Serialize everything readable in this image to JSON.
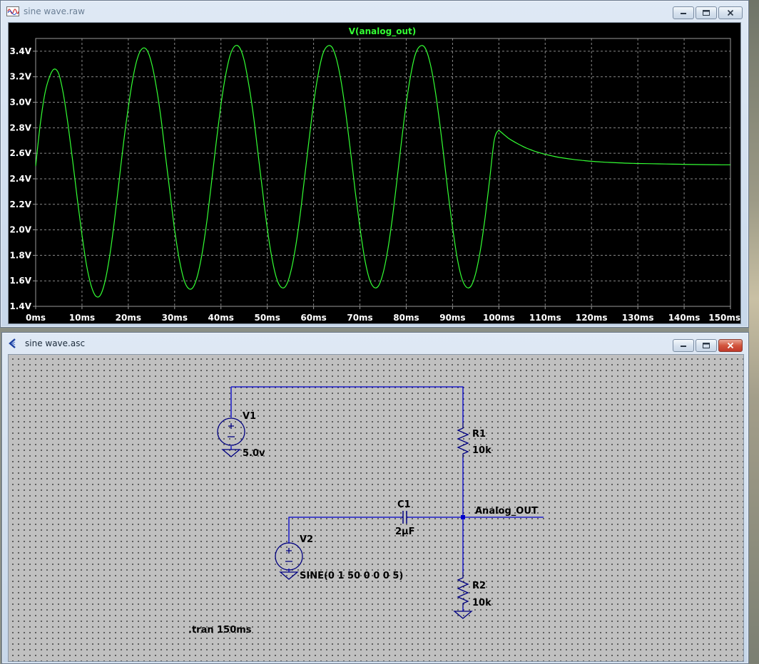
{
  "plot_window": {
    "title": "sine wave.raw",
    "icon": "waveform-icon"
  },
  "schematic_window": {
    "title": "sine wave.asc",
    "icon": "ltspice-schematic-icon"
  },
  "chart_data": {
    "type": "line",
    "title": "V(analog_out)",
    "xlabel": "",
    "ylabel": "",
    "xlim": [
      0,
      150
    ],
    "ylim": [
      1.4,
      3.5
    ],
    "x_ticks": [
      "0ms",
      "10ms",
      "20ms",
      "30ms",
      "40ms",
      "50ms",
      "60ms",
      "70ms",
      "80ms",
      "90ms",
      "100ms",
      "110ms",
      "120ms",
      "130ms",
      "140ms",
      "150ms"
    ],
    "y_ticks": [
      "1.4V",
      "1.6V",
      "1.8V",
      "2.0V",
      "2.2V",
      "2.4V",
      "2.6V",
      "2.8V",
      "3.0V",
      "3.2V",
      "3.4V"
    ],
    "y_tick_values": [
      1.4,
      1.6,
      1.8,
      2.0,
      2.2,
      2.4,
      2.6,
      2.8,
      3.0,
      3.2,
      3.4
    ],
    "grid": true,
    "series": [
      {
        "name": "V(analog_out)",
        "color": "#33ff33",
        "x": [
          0,
          1,
          2,
          3,
          4,
          5,
          6,
          7,
          8,
          9,
          10,
          11,
          12,
          13,
          14,
          15,
          16,
          17,
          18,
          19,
          20,
          21,
          22,
          23,
          24,
          25,
          26,
          27,
          28,
          29,
          30,
          31,
          32,
          33,
          34,
          35,
          36,
          37,
          38,
          39,
          40,
          41,
          42,
          43,
          44,
          45,
          46,
          47,
          48,
          49,
          50,
          51,
          52,
          53,
          54,
          55,
          56,
          57,
          58,
          59,
          60,
          61,
          62,
          63,
          64,
          65,
          66,
          67,
          68,
          69,
          70,
          71,
          72,
          73,
          74,
          75,
          76,
          77,
          78,
          79,
          80,
          81,
          82,
          83,
          84,
          85,
          86,
          87,
          88,
          89,
          90,
          91,
          92,
          93,
          94,
          95,
          96,
          97,
          98,
          99,
          100,
          101,
          102,
          103,
          104,
          105,
          106,
          107,
          108,
          109,
          110,
          112,
          114,
          116,
          118,
          120,
          122,
          124,
          126,
          128,
          130,
          133,
          136,
          139,
          142,
          145,
          148,
          150
        ],
        "y": [
          2.5,
          2.83,
          3.07,
          3.2,
          3.26,
          3.22,
          3.06,
          2.82,
          2.54,
          2.24,
          1.96,
          1.72,
          1.56,
          1.48,
          1.49,
          1.6,
          1.8,
          2.07,
          2.38,
          2.69,
          2.96,
          3.19,
          3.35,
          3.42,
          3.41,
          3.31,
          3.13,
          2.89,
          2.59,
          2.29,
          2.0,
          1.77,
          1.61,
          1.54,
          1.55,
          1.65,
          1.83,
          2.08,
          2.38,
          2.69,
          2.98,
          3.21,
          3.37,
          3.44,
          3.43,
          3.33,
          3.14,
          2.9,
          2.6,
          2.3,
          2.01,
          1.78,
          1.62,
          1.55,
          1.56,
          1.66,
          1.84,
          2.09,
          2.39,
          2.7,
          2.99,
          3.22,
          3.38,
          3.44,
          3.43,
          3.33,
          3.15,
          2.9,
          2.61,
          2.3,
          2.02,
          1.78,
          1.62,
          1.55,
          1.56,
          1.66,
          1.84,
          2.09,
          2.39,
          2.7,
          2.99,
          3.22,
          3.38,
          3.44,
          3.43,
          3.33,
          3.15,
          2.9,
          2.61,
          2.3,
          2.02,
          1.78,
          1.62,
          1.55,
          1.56,
          1.66,
          1.84,
          2.09,
          2.39,
          2.7,
          2.78,
          2.75,
          2.72,
          2.697,
          2.676,
          2.657,
          2.64,
          2.626,
          2.613,
          2.602,
          2.592,
          2.575,
          2.562,
          2.552,
          2.544,
          2.537,
          2.532,
          2.528,
          2.525,
          2.522,
          2.52,
          2.518,
          2.516,
          2.514,
          2.512,
          2.511,
          2.51,
          2.51
        ]
      }
    ]
  },
  "schematic": {
    "v1": {
      "name": "V1",
      "value": "5.0v"
    },
    "r1": {
      "name": "R1",
      "value": "10k"
    },
    "c1": {
      "name": "C1",
      "value": "2µF"
    },
    "v2": {
      "name": "V2",
      "value": "SINE(0 1 50 0 0 0 5)"
    },
    "r2": {
      "name": "R2",
      "value": "10k"
    },
    "net_label": "Analog_OUT",
    "directive": ".tran 150ms",
    "wire_color": "#0000cc",
    "component_color": "#000080"
  }
}
